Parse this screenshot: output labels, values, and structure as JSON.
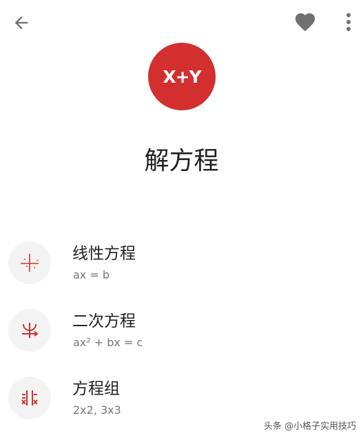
{
  "colors": {
    "accent": "#d32f2f",
    "icon_gray": "#707070",
    "subtitle": "#777777",
    "icon_bg": "#f3f3f3"
  },
  "header": {
    "back_icon": "arrow-left-icon",
    "favorite_icon": "heart-icon",
    "more_icon": "more-vert-icon"
  },
  "logo": {
    "text": "X+Y"
  },
  "page": {
    "title": "解方程"
  },
  "items": [
    {
      "title": "线性方程",
      "subtitle": "ax = b",
      "icon": "linear-graph-icon"
    },
    {
      "title": "二次方程",
      "subtitle": "ax² + bx = c",
      "icon": "quadratic-icon"
    },
    {
      "title": "方程组",
      "subtitle": "2x2, 3x3",
      "icon": "system-equations-icon"
    }
  ],
  "watermark": {
    "text": "头条 @小格子实用技巧"
  }
}
